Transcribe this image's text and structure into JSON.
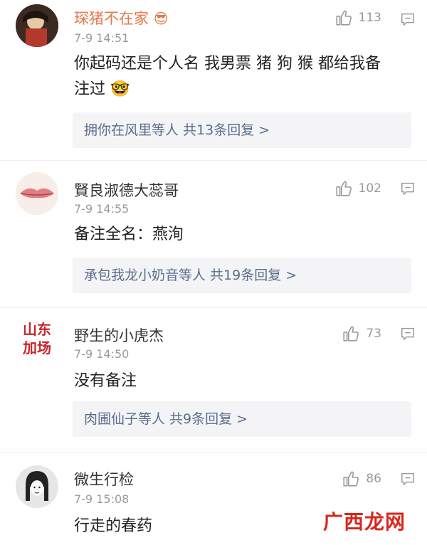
{
  "comments": [
    {
      "name": "琛猪不在家",
      "time": "7-9 14:51",
      "likes": "113",
      "text_line1": "你起码还是个人名 我男票 猪 狗 猴 都给我备",
      "text_line2": "注过",
      "replies": "拥你在风里等人  共13条回复 >"
    },
    {
      "name": "賢良淑德大蕊哥",
      "time": "7-9 14:55",
      "likes": "102",
      "text_line1": "备注全名：燕洵",
      "replies": "承包我龙小奶音等人  共19条回复 >"
    },
    {
      "name": "野生的小虎杰",
      "time": "7-9 14:50",
      "likes": "73",
      "text_line1": "没有备注",
      "replies": "肉圃仙子等人  共9条回复 >",
      "avatar_text_top": "山东",
      "avatar_text_bottom": "加场"
    },
    {
      "name": "微生行检",
      "time": "7-9 15:08",
      "likes": "86",
      "text_line1": "行走的春药"
    }
  ],
  "watermark": "广西龙网",
  "colors": {
    "accent_name": "#e6784a",
    "reply_link": "#5a6e8c",
    "watermark": "#d9261c"
  }
}
